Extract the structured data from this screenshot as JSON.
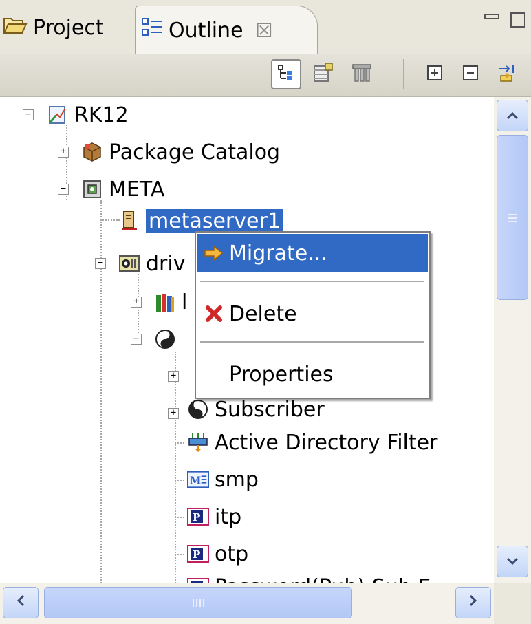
{
  "tabs": {
    "project_label": "Project",
    "outline_label": "Outline",
    "close_glyph": "☒"
  },
  "toolbar": {
    "buttons": [
      "tree-view-icon",
      "table-view-icon",
      "filter-icon",
      "expand-all-icon",
      "collapse-all-icon",
      "link-icon"
    ]
  },
  "tree": {
    "items": [
      {
        "label": "RK12",
        "icon": "project-icon"
      },
      {
        "label": "Package Catalog",
        "icon": "package-catalog-icon"
      },
      {
        "label": "META",
        "icon": "meta-icon"
      },
      {
        "label": "metaserver1",
        "icon": "server-icon",
        "selected": true
      },
      {
        "label": "driv",
        "icon": "driverset-icon"
      },
      {
        "label": "l",
        "icon": "library-icon"
      },
      {
        "label": "",
        "icon": "driver-icon"
      },
      {
        "label": "",
        "icon": "publisher-icon"
      },
      {
        "label": "Subscriber",
        "icon": "subscriber-icon"
      },
      {
        "label": "Active Directory Filter",
        "icon": "filter-icon"
      },
      {
        "label": "smp",
        "icon": "mapping-icon"
      },
      {
        "label": "itp",
        "icon": "policy-icon"
      },
      {
        "label": "otp",
        "icon": "policy-icon"
      },
      {
        "label": "Password(Pub) Sub E",
        "icon": "policy-icon"
      }
    ]
  },
  "context_menu": {
    "migrate": "Migrate...",
    "delete": "Delete",
    "properties": "Properties"
  },
  "colors": {
    "selection": "#316ac5",
    "scroll_thumb": "#c6d6fb"
  }
}
